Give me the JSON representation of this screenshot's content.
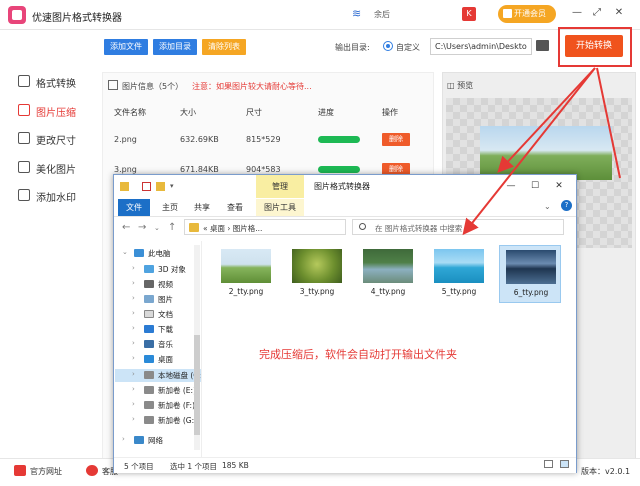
{
  "app": {
    "title": "优速图片格式转换器",
    "user_name": "余后",
    "vip_label": "开通会员",
    "window_controls": [
      "minimize-icon",
      "restore-icon",
      "close-icon"
    ]
  },
  "toolbar": {
    "add_file": "添加文件",
    "add_folder": "添加目录",
    "clear_list": "清除列表",
    "output_label": "输出目录:",
    "custom_label": "自定义",
    "output_path": "C:\\Users\\admin\\Deskto",
    "start_label": "开始转换"
  },
  "sidebar": {
    "items": [
      {
        "label": "格式转换",
        "icon": "format-convert-icon"
      },
      {
        "label": "图片压缩",
        "icon": "image-compress-icon"
      },
      {
        "label": "更改尺寸",
        "icon": "resize-icon"
      },
      {
        "label": "美化图片",
        "icon": "beautify-icon"
      },
      {
        "label": "添加水印",
        "icon": "watermark-icon"
      }
    ],
    "active_index": 1
  },
  "file_panel": {
    "info_label": "图片信息（5个）",
    "info_note": "注意：如果图片较大请耐心等待...",
    "columns": [
      "文件名称",
      "大小",
      "尺寸",
      "进度",
      "操作"
    ],
    "rows": [
      {
        "name": "2.png",
        "size": "632.69KB",
        "dims": "815*529",
        "progress": 1.0,
        "action": "删除"
      },
      {
        "name": "3.png",
        "size": "671.84KB",
        "dims": "904*583",
        "progress": 1.0,
        "action": "删除"
      }
    ]
  },
  "preview": {
    "title": "预览"
  },
  "bottom_bar": {
    "official_site": "官方网址",
    "service": "客服",
    "version": "版本：v2.0.1"
  },
  "explorer": {
    "title": "图片格式转换器",
    "manage_tab": "管理",
    "tools_tab": "图片工具",
    "ribbon_tabs": [
      "文件",
      "主页",
      "共享",
      "查看"
    ],
    "address": "«  桌面  ›  图片格...",
    "search_placeholder": "在 图片格式转换器 中搜索",
    "tree": [
      {
        "label": "此电脑",
        "icon": "pc-icon"
      },
      {
        "label": "3D 对象",
        "icon": "3d-objects-icon"
      },
      {
        "label": "视频",
        "icon": "video-icon"
      },
      {
        "label": "图片",
        "icon": "pictures-icon"
      },
      {
        "label": "文档",
        "icon": "documents-icon"
      },
      {
        "label": "下载",
        "icon": "download-icon"
      },
      {
        "label": "音乐",
        "icon": "music-icon"
      },
      {
        "label": "桌面",
        "icon": "desktop-icon"
      },
      {
        "label": "本地磁盘 (C:",
        "icon": "drive-icon"
      },
      {
        "label": "新加卷 (E:)",
        "icon": "drive-icon"
      },
      {
        "label": "新加卷 (F:)",
        "icon": "drive-icon"
      },
      {
        "label": "新加卷 (G:)",
        "icon": "drive-icon"
      },
      {
        "label": "网络",
        "icon": "network-icon"
      }
    ],
    "files": [
      {
        "name": "2_tty.png",
        "selected": false
      },
      {
        "name": "3_tty.png",
        "selected": false
      },
      {
        "name": "4_tty.png",
        "selected": false
      },
      {
        "name": "5_tty.png",
        "selected": false
      },
      {
        "name": "6_tty.png",
        "selected": true
      }
    ],
    "status_count": "5 个项目",
    "status_selected": "选中 1 个项目",
    "status_size": "185 KB"
  },
  "annotation": {
    "text": "完成压缩后，软件会自动打开输出文件夹",
    "color": "#e53935"
  },
  "colors": {
    "accent_blue": "#2f7de1",
    "accent_orange": "#f5a623",
    "start_red": "#f0531d",
    "progress_green": "#1db954"
  }
}
